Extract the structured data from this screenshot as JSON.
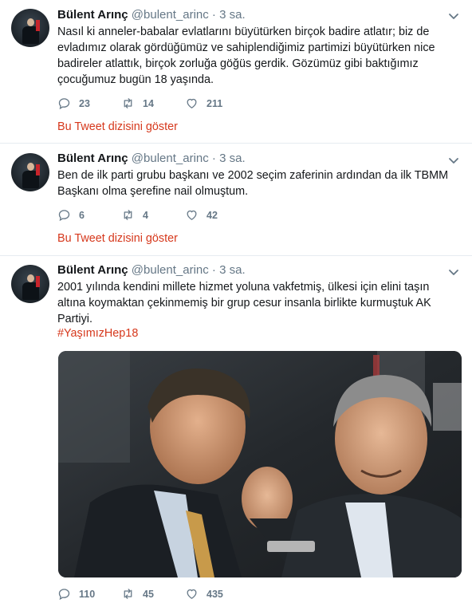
{
  "tweets": [
    {
      "name": "Bülent Arınç",
      "handle": "@bulent_arinc",
      "separator": "·",
      "time": "3 sa.",
      "text": "Nasıl ki anneler-babalar evlatlarını büyütürken birçok badire atlatır; biz de evladımız olarak gördüğümüz ve sahiplendiğimiz partimizi büyütürken nice badireler atlattık, birçok zorluğa göğüs gerdik. Gözümüz gibi baktığımız çocuğumuz bugün 18 yaşında.",
      "replies": "23",
      "retweets": "14",
      "likes": "211",
      "thread_link": "Bu Tweet dizisini göster"
    },
    {
      "name": "Bülent Arınç",
      "handle": "@bulent_arinc",
      "separator": "·",
      "time": "3 sa.",
      "text": "Ben de ilk parti grubu başkanı ve 2002 seçim zaferinin ardından da ilk TBMM Başkanı olma şerefine nail olmuştum.",
      "replies": "6",
      "retweets": "4",
      "likes": "42",
      "thread_link": "Bu Tweet dizisini göster"
    },
    {
      "name": "Bülent Arınç",
      "handle": "@bulent_arinc",
      "separator": "·",
      "time": "3 sa.",
      "text": "2001 yılında kendini millete hizmet yoluna vakfetmiş, ülkesi için elini taşın altına koymaktan çekinmemiş bir grup cesur insanla birlikte kurmuştuk AK Partiyi.",
      "hashtag": "#YaşımızHep18",
      "replies": "110",
      "retweets": "45",
      "likes": "435"
    }
  ],
  "colors": {
    "link": "#d6381c",
    "muted": "#657786",
    "text": "#14171a",
    "divider": "#e6ecf0"
  },
  "icons": [
    "reply-icon",
    "retweet-icon",
    "like-icon",
    "chevron-down-icon"
  ]
}
